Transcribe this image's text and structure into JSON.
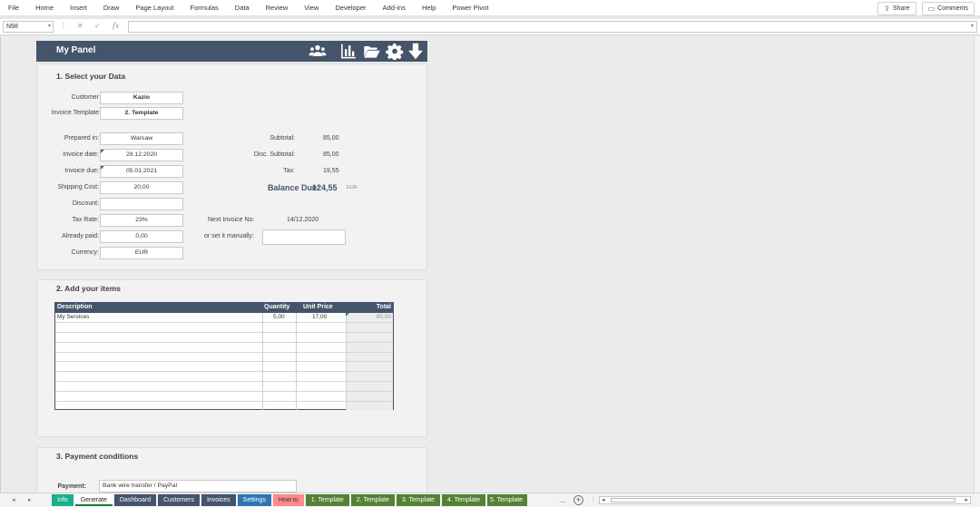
{
  "ribbon": {
    "menu": [
      "File",
      "Home",
      "Insert",
      "Draw",
      "Page Layout",
      "Formulas",
      "Data",
      "Review",
      "View",
      "Developer",
      "Add-ins",
      "Help",
      "Power Pivot"
    ],
    "share_label": "Share",
    "comments_label": "Comments"
  },
  "formula_bar": {
    "name_box": "N98",
    "fx": "fx",
    "value": ""
  },
  "panel": {
    "title": "My Panel"
  },
  "section1": {
    "title": "1. Select your Data",
    "customer_label": "Customer",
    "customer": "Kazio",
    "template_label": "Invoice Template",
    "template": "2. Template",
    "prepared_in_label": "Prepared in:",
    "prepared_in": "Warsaw",
    "invoice_date_label": "Invoice date:",
    "invoice_date": "29.12.2020",
    "invoice_due_label": "Invoice due:",
    "invoice_due": "05.01.2021",
    "shipping_label": "Shipping Cost:",
    "shipping": "20,00",
    "discount_label": "Discount:",
    "discount": "",
    "tax_rate_label": "Tax Rate:",
    "tax_rate": "23%",
    "already_paid_label": "Already paid:",
    "already_paid": "0,00",
    "currency_label": "Currency:",
    "currency": "EUR",
    "subtotal_label": "Subtotal:",
    "subtotal": "85,00",
    "disc_subtotal_label": "Disc. Subtotal:",
    "disc_subtotal": "85,00",
    "tax_label": "Tax:",
    "tax": "19,55",
    "balance_label": "Balance Due:",
    "balance": "124,55",
    "balance_currency": "EUR",
    "next_invoice_label": "Next Invoice No:",
    "next_invoice": "14/12.2020",
    "manual_label": "or set it manually:",
    "manual": ""
  },
  "section2": {
    "title": "2. Add your items",
    "headers": {
      "description": "Description",
      "quantity": "Quantity",
      "unit_price": "Unit Price",
      "total": "Total"
    },
    "rows": [
      {
        "description": "My Services",
        "quantity": "5,00",
        "unit_price": "17,00",
        "total": "85,00"
      }
    ]
  },
  "section3": {
    "title": "3. Payment conditions",
    "payment_label": "Payment:",
    "payment": "Bank wire transfer / PayPal"
  },
  "sheet_tabs": [
    {
      "label": "Info",
      "color": "#1aaf8b"
    },
    {
      "label": "Generate",
      "color": "#ffffff"
    },
    {
      "label": "Dashboard",
      "color": "#44546a"
    },
    {
      "label": "Customers",
      "color": "#44546a"
    },
    {
      "label": "Invoices",
      "color": "#44546a"
    },
    {
      "label": "Settings",
      "color": "#2e75b6"
    },
    {
      "label": "How to",
      "color": "#ff8a8a"
    },
    {
      "label": "1. Template",
      "color": "#548235"
    },
    {
      "label": "2. Template",
      "color": "#548235"
    },
    {
      "label": "3. Template",
      "color": "#548235"
    },
    {
      "label": "4. Template",
      "color": "#548235"
    },
    {
      "label": "5. Template",
      "color": "#548235"
    }
  ],
  "tab_more": "...",
  "icons": [
    "users-icon",
    "bar-chart-icon",
    "folder-open-icon",
    "gear-icon",
    "download-arrow-icon"
  ]
}
